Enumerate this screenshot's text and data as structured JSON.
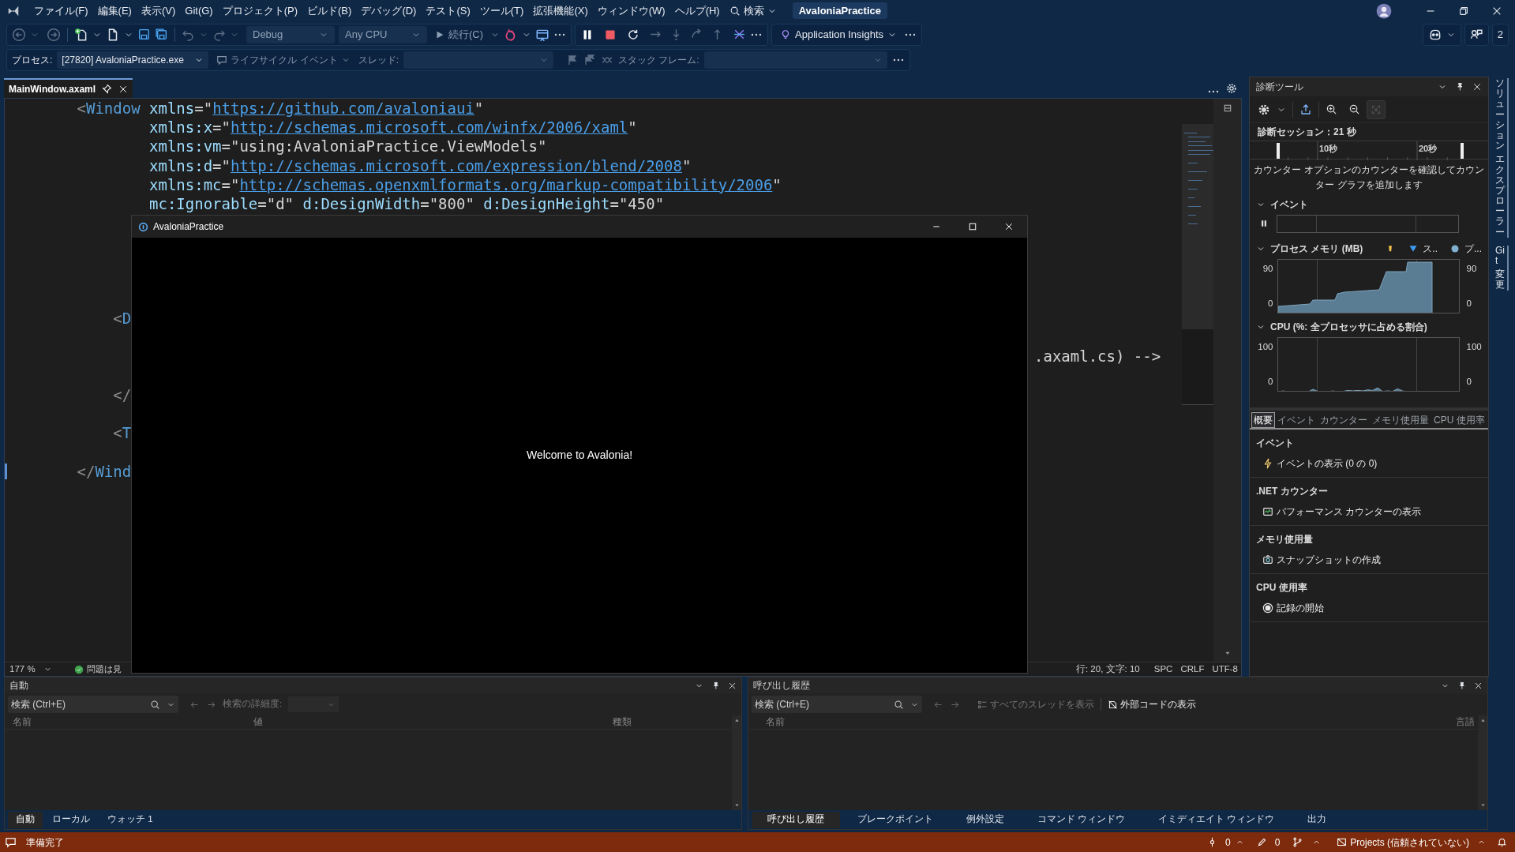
{
  "menu_bar": {
    "items": [
      "ファイル(F)",
      "編集(E)",
      "表示(V)",
      "Git(G)",
      "プロジェクト(P)",
      "ビルド(B)",
      "デバッグ(D)",
      "テスト(S)",
      "ツール(T)",
      "拡張機能(X)",
      "ウィンドウ(W)",
      "ヘルプ(H)"
    ],
    "search": "検索",
    "solution": "AvaloniaPractice"
  },
  "toolbar": {
    "configuration": "Debug",
    "platform": "Any CPU",
    "continue": "続行(C)",
    "insights": "Application Insights",
    "count": "2"
  },
  "debug_location": {
    "process_label": "プロセス:",
    "process": "[27820] AvaloniaPractice.exe",
    "lifecycle": "ライフサイクル イベント",
    "thread_label": "スレッド:",
    "stack_label": "スタック フレーム:"
  },
  "editor": {
    "tabs": [
      {
        "label": "MainWindow.axaml",
        "selected": true
      }
    ],
    "lines": [
      {
        "segments": [
          {
            "kind": "punct",
            "text": "<"
          },
          {
            "kind": "tag",
            "text": "Window"
          },
          {
            "kind": "attr",
            "text": " xmlns"
          },
          {
            "kind": "text",
            "text": "=\""
          },
          {
            "kind": "link",
            "text": "https://github.com/avaloniaui"
          },
          {
            "kind": "text",
            "text": "\""
          }
        ]
      },
      {
        "segments": [
          {
            "kind": "attr",
            "text": "xmlns:x"
          },
          {
            "kind": "text",
            "text": "=\""
          },
          {
            "kind": "link",
            "text": "http://schemas.microsoft.com/winfx/2006/xaml"
          },
          {
            "kind": "text",
            "text": "\""
          }
        ]
      },
      {
        "segments": [
          {
            "kind": "attr",
            "text": "xmlns:vm"
          },
          {
            "kind": "text",
            "text": "=\"using:AvaloniaPractice.ViewModels\""
          }
        ]
      },
      {
        "segments": [
          {
            "kind": "attr",
            "text": "xmlns:d"
          },
          {
            "kind": "text",
            "text": "=\""
          },
          {
            "kind": "link",
            "text": "http://schemas.microsoft.com/expression/blend/2008"
          },
          {
            "kind": "text",
            "text": "\""
          }
        ]
      },
      {
        "segments": [
          {
            "kind": "attr",
            "text": "xmlns:mc"
          },
          {
            "kind": "text",
            "text": "=\""
          },
          {
            "kind": "link",
            "text": "http://schemas.openxmlformats.org/markup-compatibility/2006"
          },
          {
            "kind": "text",
            "text": "\""
          }
        ]
      },
      {
        "segments": [
          {
            "kind": "attr",
            "text": "mc:Ignorable"
          },
          {
            "kind": "text",
            "text": "=\"d\" "
          },
          {
            "kind": "attr",
            "text": "d:DesignWidth"
          },
          {
            "kind": "text",
            "text": "=\"800\" "
          },
          {
            "kind": "attr",
            "text": "d:DesignHeight"
          },
          {
            "kind": "text",
            "text": "=\"450\""
          }
        ]
      },
      {
        "segments": [
          {
            "kind": "punct",
            "text": "<"
          },
          {
            "kind": "tag",
            "text": "D"
          }
        ]
      },
      {
        "segments": [
          {
            "kind": "text",
            "text": ".axaml.cs) -->"
          }
        ]
      },
      {
        "segments": [
          {
            "kind": "punct",
            "text": "</"
          }
        ]
      },
      {
        "segments": [
          {
            "kind": "punct",
            "text": "<"
          },
          {
            "kind": "tag",
            "text": "T"
          }
        ]
      },
      {
        "segments": [
          {
            "kind": "punct",
            "text": "</"
          },
          {
            "kind": "tag",
            "text": "Wind"
          }
        ]
      }
    ],
    "zoom": "177 %",
    "issues": "問題は見",
    "position": "行: 20, 文字: 10",
    "indent": "SPC",
    "line_ending": "CRLF",
    "encoding": "UTF-8"
  },
  "app_window": {
    "title": "AvaloniaPractice",
    "message": "Welcome to Avalonia!"
  },
  "diagnostics": {
    "title": "診断ツール",
    "session": "診断セッション：21 秒",
    "timeline": [
      "10秒",
      "20秒"
    ],
    "hint": "カウンター オプションのカウンターを確認してカウンター グラフを追加します",
    "events": {
      "title": "イベント",
      "expanded": true
    },
    "memory": {
      "title": "プロセス メモリ (MB)",
      "expanded": true,
      "legend": [
        "ス..",
        "プ..."
      ],
      "left_labels": [
        "90",
        "0"
      ],
      "right_labels": [
        "90",
        "0"
      ]
    },
    "cpu": {
      "title": "CPU (%: 全プロセッサに占める割合)",
      "expanded": true,
      "left_labels": [
        "100",
        "0"
      ],
      "right_labels": [
        "100",
        "0"
      ]
    },
    "tabs": [
      {
        "label": "概要",
        "selected": true
      },
      {
        "label": "イベント",
        "selected": false
      },
      {
        "label": "カウンター",
        "selected": false
      },
      {
        "label": "メモリ使用量",
        "selected": false
      },
      {
        "label": "CPU 使用率",
        "selected": false
      }
    ],
    "sections": [
      {
        "title": "イベント",
        "item": {
          "kind": "events",
          "label": "イベントの表示 (0 の 0)"
        }
      },
      {
        "title": ".NET カウンター",
        "item": {
          "kind": "counters",
          "label": "パフォーマンス カウンターの表示"
        }
      },
      {
        "title": "メモリ使用量",
        "item": {
          "kind": "snapshot",
          "label": "スナップショットの作成"
        }
      },
      {
        "title": "CPU 使用率",
        "item": {
          "kind": "record",
          "label": "記録の開始"
        }
      }
    ]
  },
  "side_tabs": [
    {
      "words": [
        "ソリューション",
        "エクスプローラー"
      ]
    },
    {
      "words": [
        "Git",
        "変更"
      ]
    }
  ],
  "autos_panel": {
    "title": "自動",
    "search_placeholder": "検索 (Ctrl+E)",
    "depth_label": "検索の詳細度:",
    "columns": [
      "名前",
      "値",
      "種類"
    ],
    "tabs": [
      {
        "label": "自動",
        "selected": true
      },
      {
        "label": "ローカル",
        "selected": false
      },
      {
        "label": "ウォッチ 1",
        "selected": false
      }
    ]
  },
  "call_stack_panel": {
    "title": "呼び出し履歴",
    "search_placeholder": "検索 (Ctrl+E)",
    "show_threads": "すべてのスレッドを表示",
    "external_code": "外部コードの表示",
    "columns": [
      "名前",
      "言語"
    ],
    "tabs": [
      {
        "label": "呼び出し履歴",
        "selected": true
      },
      {
        "label": "ブレークポイント",
        "selected": false
      },
      {
        "label": "例外設定",
        "selected": false
      },
      {
        "label": "コマンド ウィンドウ",
        "selected": false
      },
      {
        "label": "イミディエイト ウィンドウ",
        "selected": false
      },
      {
        "label": "出力",
        "selected": false
      }
    ]
  },
  "status_bar": {
    "message": "準備完了",
    "commits": "0",
    "changes": "0",
    "project": "Projects (信頼されていない)"
  }
}
